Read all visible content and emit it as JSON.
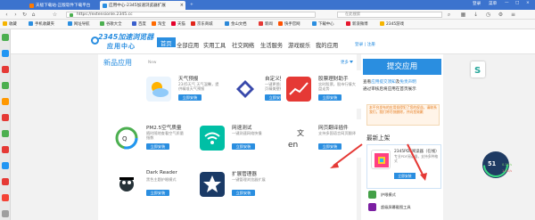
{
  "browser": {
    "tabs": [
      {
        "title": "天极下载站-正版软件下载平台"
      },
      {
        "title": "应用中心-2345加速浏览器扩展"
      }
    ],
    "window_controls": {
      "login_label": "登录",
      "menu_label": "菜单"
    },
    "address": {
      "url": "https://extensionle.2345.cc",
      "search_placeholder": "在此搜索"
    },
    "bookmarks": [
      "收藏",
      "手机收藏夹",
      "网址导航",
      "谷歌大全",
      "百度",
      "淘宝",
      "天猫",
      "京东商城",
      "金山文档",
      "新闻",
      "快手官网",
      "下载中心",
      "新浪微博",
      "2345游戏"
    ]
  },
  "header": {
    "logo_top": "2345加速浏览器",
    "logo_bottom": "应用中心",
    "nav": [
      "首页",
      "全部应用",
      "实用工具",
      "社交网络",
      "生活服务",
      "游戏娱乐",
      "我的应用"
    ],
    "login": "登录 | 注册"
  },
  "section": {
    "title": "新品应用",
    "subtitle": "New",
    "more": "更多"
  },
  "apps": [
    {
      "name": "天气预报",
      "desc": "2345天气 天气温馨，提供精准天气预报",
      "button": "立即安装"
    },
    {
      "name": "自定义壁纸",
      "desc": "一键更换浏览器新标签页精美壁纸",
      "button": "立即安装"
    },
    {
      "name": "股票理财助手",
      "desc": "实时股票，股市行情大盘走势",
      "button": "立即安装"
    },
    {
      "name": "PM2.5空气质量",
      "desc": "随时随地查看空气质量指数",
      "button": "立即安装"
    },
    {
      "name": "网速测试",
      "desc": "一键测速网络快慢",
      "button": "立即安装"
    },
    {
      "name": "网页翻译插件",
      "desc": "支持多国语言网页翻译",
      "button": "立即安装"
    },
    {
      "name": "Dark Reader",
      "desc": "黑色主题护眼模式",
      "button": "立即安装"
    },
    {
      "name": "扩展管理器",
      "desc": "一键管理浏览器扩展",
      "button": "立即安装"
    }
  ],
  "sidebar": {
    "submit_label": "提交应用",
    "line1_prefix": "查看",
    "line1_link": "应用提交须知",
    "line1_mid": "及",
    "line1_link2": "免责声明",
    "line2": "通过审核后将应用在首页展示",
    "notice": "本平台发布的应用如侵犯了您的权益，请联系我们，我们将尽快删除，并向您致歉",
    "new_title": "最新上架",
    "new_app": {
      "name": "2345PDF阅读器（在线）",
      "desc": "专业PDF阅读器，支持多种格式",
      "button": "立即安装"
    },
    "mini": [
      {
        "name": "护眼模式"
      },
      {
        "name": "超级屏幕截图工具"
      }
    ]
  },
  "widget": {
    "value": "51",
    "down": "0.3K/s",
    "up": "1.2K/s"
  },
  "colors": {
    "brand": "#2a8ee0",
    "tabbar": "#3c73ce"
  }
}
